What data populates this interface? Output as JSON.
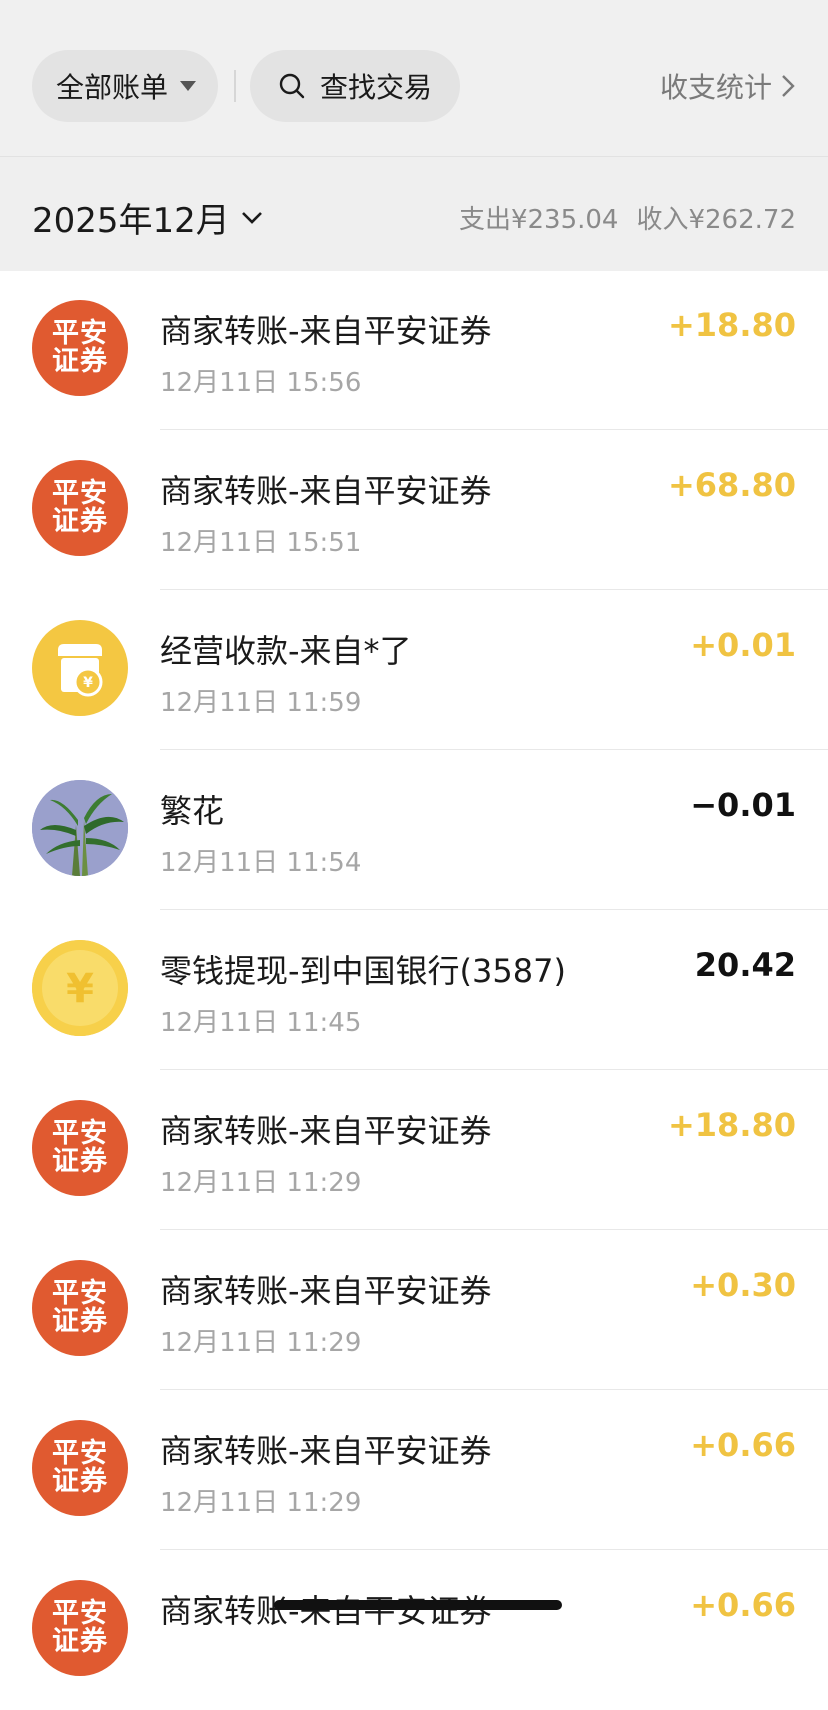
{
  "header": {
    "filter_label": "全部账单",
    "search_label": "查找交易",
    "stats_label": "收支统计"
  },
  "month_bar": {
    "month_label": "2025年12月",
    "expense_text": "支出¥235.04",
    "income_text": "收入¥262.72"
  },
  "transactions": [
    {
      "icon": "pingan-securities-logo",
      "avatar_line1": "平安",
      "avatar_line2": "证券",
      "title": "商家转账-来自平安证券",
      "time": "12月11日 15:56",
      "amount": "+18.80",
      "direction": "in"
    },
    {
      "icon": "pingan-securities-logo",
      "avatar_line1": "平安",
      "avatar_line2": "证券",
      "title": "商家转账-来自平安证券",
      "time": "12月11日 15:51",
      "amount": "+68.80",
      "direction": "in"
    },
    {
      "icon": "shop-payment-icon",
      "title": "经营收款-来自*了",
      "time": "12月11日 11:59",
      "amount": "+0.01",
      "direction": "in"
    },
    {
      "icon": "bamboo-plant-avatar",
      "title": "繁花",
      "time": "12月11日 11:54",
      "amount": "−0.01",
      "direction": "out"
    },
    {
      "icon": "yuan-coin-icon",
      "title": "零钱提现-到中国银行(3587)",
      "time": "12月11日 11:45",
      "amount": "20.42",
      "direction": "out"
    },
    {
      "icon": "pingan-securities-logo",
      "avatar_line1": "平安",
      "avatar_line2": "证券",
      "title": "商家转账-来自平安证券",
      "time": "12月11日 11:29",
      "amount": "+18.80",
      "direction": "in"
    },
    {
      "icon": "pingan-securities-logo",
      "avatar_line1": "平安",
      "avatar_line2": "证券",
      "title": "商家转账-来自平安证券",
      "time": "12月11日 11:29",
      "amount": "+0.30",
      "direction": "in"
    },
    {
      "icon": "pingan-securities-logo",
      "avatar_line1": "平安",
      "avatar_line2": "证券",
      "title": "商家转账-来自平安证券",
      "time": "12月11日 11:29",
      "amount": "+0.66",
      "direction": "in"
    },
    {
      "icon": "pingan-securities-logo",
      "avatar_line1": "平安",
      "avatar_line2": "证券",
      "title": "商家转账-来自平安证券",
      "time": "",
      "amount": "+0.66",
      "direction": "in"
    }
  ],
  "colors": {
    "income": "#f0c342",
    "expense": "#111111",
    "pingan_red": "#e05a30",
    "shop_yellow": "#f4c742"
  }
}
